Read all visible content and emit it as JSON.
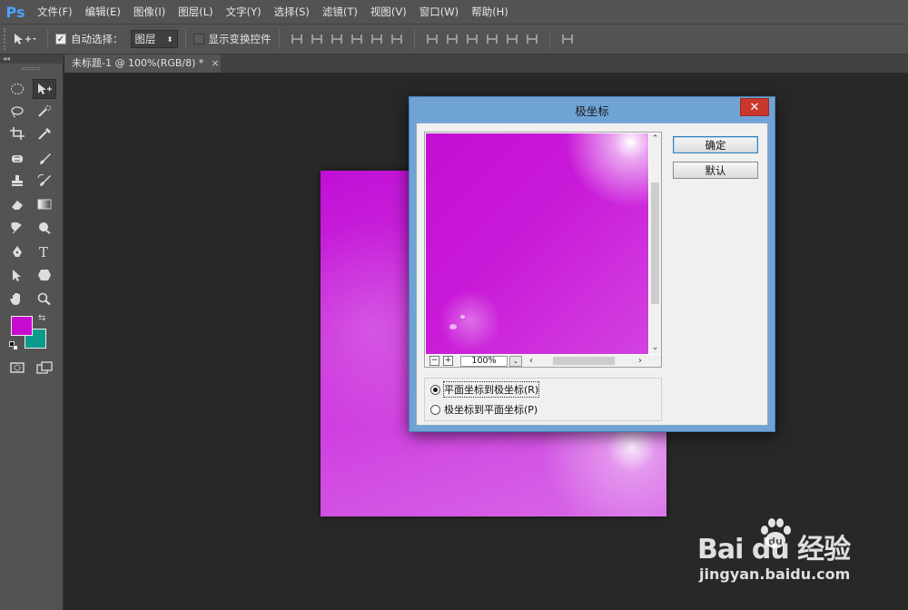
{
  "app": {
    "logo": "Ps",
    "menus": [
      "文件(F)",
      "编辑(E)",
      "图像(I)",
      "图层(L)",
      "文字(Y)",
      "选择(S)",
      "滤镜(T)",
      "视图(V)",
      "窗口(W)",
      "帮助(H)"
    ]
  },
  "options": {
    "auto_select_label": "自动选择：",
    "auto_select_checked": true,
    "auto_select_value": "图层",
    "transform_label": "显示变换控件",
    "transform_checked": false
  },
  "panel": {
    "collapse_glyph": "◂◂"
  },
  "document": {
    "tab_title": "未标题-1 @ 100%(RGB/8) *",
    "close_glyph": "×"
  },
  "colors": {
    "foreground": "#c80ccf",
    "background": "#0a9b8c",
    "ui_bg": "#535353",
    "dialog_frame": "#6fa3d6"
  },
  "dialog": {
    "title": "极坐标",
    "close_glyph": "✕",
    "ok_label": "确定",
    "default_label": "默认",
    "zoom_value": "100%",
    "zoom_out": "−",
    "zoom_in": "+",
    "options": [
      {
        "label": "平面坐标到极坐标(R)",
        "selected": true
      },
      {
        "label": "极坐标到平面坐标(P)",
        "selected": false
      }
    ]
  },
  "watermark": {
    "brand": "Bai  du 经验",
    "url": "jingyan.baidu.com"
  }
}
